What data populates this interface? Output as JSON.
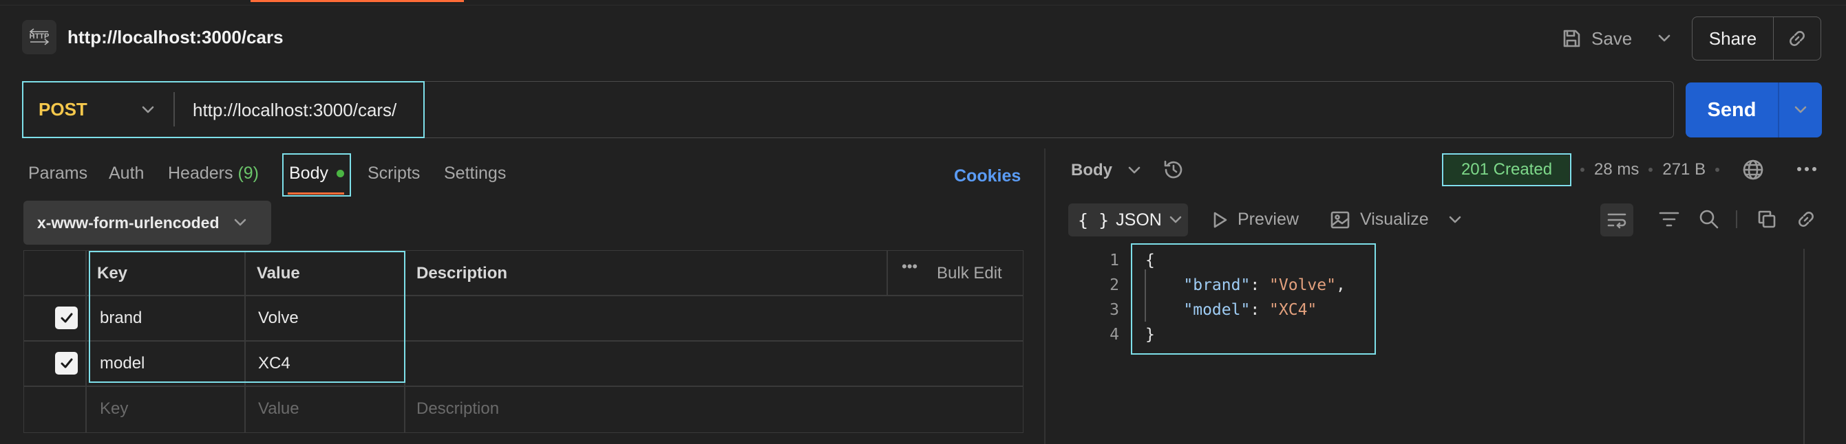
{
  "request": {
    "title": "http://localhost:3000/cars",
    "icon": "http-icon"
  },
  "header": {
    "save_label": "Save",
    "share_label": "Share"
  },
  "url_bar": {
    "method": "POST",
    "url": "http://localhost:3000/cars/",
    "send_label": "Send"
  },
  "tabs": {
    "params": "Params",
    "auth": "Auth",
    "headers": "Headers",
    "headers_count": "(9)",
    "body": "Body",
    "scripts": "Scripts",
    "settings": "Settings",
    "cookies": "Cookies",
    "active": "Body"
  },
  "body_type": "x-www-form-urlencoded",
  "kv_table": {
    "headers": {
      "key": "Key",
      "value": "Value",
      "description": "Description",
      "bulk_edit": "Bulk Edit"
    },
    "rows": [
      {
        "checked": true,
        "key": "brand",
        "value": "Volve",
        "description": ""
      },
      {
        "checked": true,
        "key": "model",
        "value": "XC4",
        "description": ""
      }
    ],
    "placeholders": {
      "key": "Key",
      "value": "Value",
      "description": "Description"
    }
  },
  "response": {
    "view_label": "Body",
    "status": "201 Created",
    "status_color": "#7ed98a",
    "time": "28 ms",
    "size": "271 B",
    "format": "JSON",
    "preview_label": "Preview",
    "visualize_label": "Visualize",
    "code_lines": [
      {
        "num": "1",
        "text": "{"
      },
      {
        "num": "2",
        "key": "\"brand\"",
        "value": "\"Volve\"",
        "suffix": ","
      },
      {
        "num": "3",
        "key": "\"model\"",
        "value": "\"XC4\"",
        "suffix": ""
      },
      {
        "num": "4",
        "text": "}"
      }
    ]
  },
  "colors": {
    "accent": "#ff6c37",
    "send": "#1f60d1",
    "method": "#f5c84c",
    "highlight": "#7ee0ea"
  }
}
